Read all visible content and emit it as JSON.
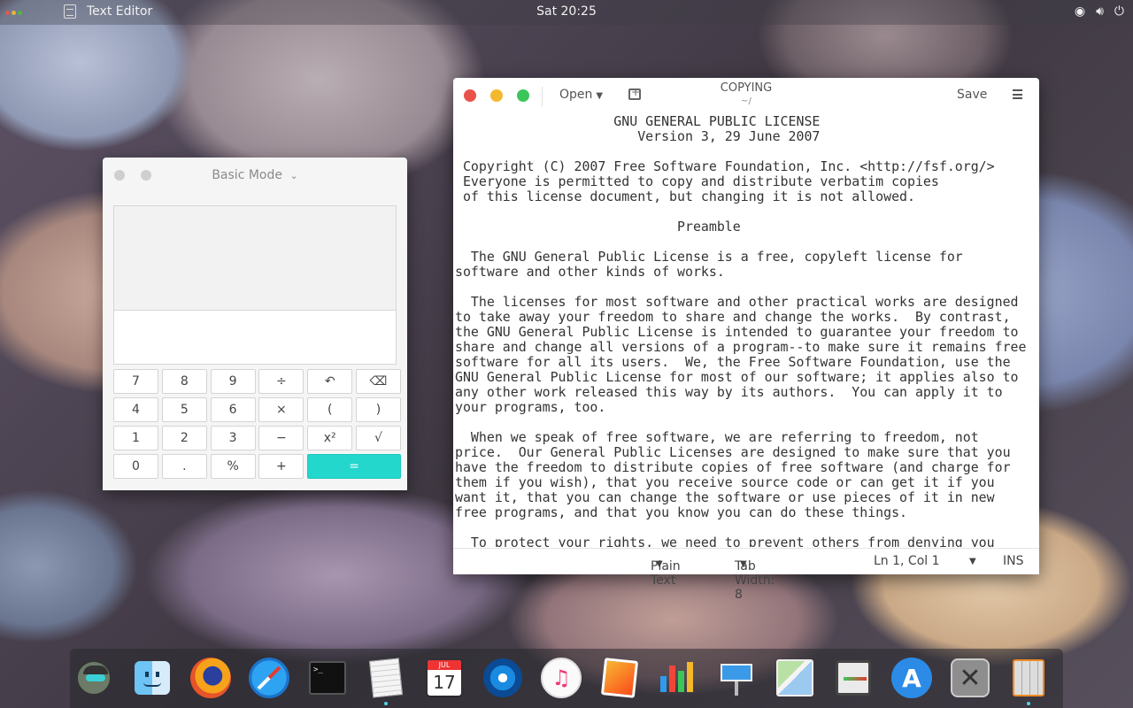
{
  "top_panel": {
    "app_name": "Text Editor",
    "clock": "Sat 20:25"
  },
  "calculator": {
    "mode": "Basic Mode",
    "keys": [
      {
        "label": "7",
        "name": "key-7"
      },
      {
        "label": "8",
        "name": "key-8"
      },
      {
        "label": "9",
        "name": "key-9"
      },
      {
        "label": "÷",
        "name": "key-divide"
      },
      {
        "label": "↶",
        "name": "undo-key"
      },
      {
        "label": "⌫",
        "name": "backspace-key"
      },
      {
        "label": "4",
        "name": "key-4"
      },
      {
        "label": "5",
        "name": "key-5"
      },
      {
        "label": "6",
        "name": "key-6"
      },
      {
        "label": "×",
        "name": "key-multiply"
      },
      {
        "label": "(",
        "name": "key-open-paren"
      },
      {
        "label": ")",
        "name": "key-close-paren"
      },
      {
        "label": "1",
        "name": "key-1"
      },
      {
        "label": "2",
        "name": "key-2"
      },
      {
        "label": "3",
        "name": "key-3"
      },
      {
        "label": "−",
        "name": "key-minus"
      },
      {
        "label": "x²",
        "name": "key-square"
      },
      {
        "label": "√",
        "name": "key-sqrt"
      },
      {
        "label": "0",
        "name": "key-0"
      },
      {
        "label": ".",
        "name": "key-decimal"
      },
      {
        "label": "%",
        "name": "key-percent"
      },
      {
        "label": "+",
        "name": "key-plus"
      },
      {
        "label": "=",
        "name": "key-equals"
      }
    ]
  },
  "editor": {
    "open_label": "Open",
    "title": "COPYING",
    "subtitle": "~/",
    "save_label": "Save",
    "content_lines": [
      "                    GNU GENERAL PUBLIC LICENSE",
      "                       Version 3, 29 June 2007",
      "",
      " Copyright (C) 2007 Free Software Foundation, Inc. <http://fsf.org/>",
      " Everyone is permitted to copy and distribute verbatim copies",
      " of this license document, but changing it is not allowed.",
      "",
      "                            Preamble",
      "",
      "  The GNU General Public License is a free, copyleft license for",
      "software and other kinds of works.",
      "",
      "  The licenses for most software and other practical works are designed",
      "to take away your freedom to share and change the works.  By contrast,",
      "the GNU General Public License is intended to guarantee your freedom to",
      "share and change all versions of a program--to make sure it remains free",
      "software for all its users.  We, the Free Software Foundation, use the",
      "GNU General Public License for most of our software; it applies also to",
      "any other work released this way by its authors.  You can apply it to",
      "your programs, too.",
      "",
      "  When we speak of free software, we are referring to freedom, not",
      "price.  Our General Public Licenses are designed to make sure that you",
      "have the freedom to distribute copies of free software (and charge for",
      "them if you wish), that you receive source code or can get it if you",
      "want it, that you can change the software or use pieces of it in new",
      "free programs, and that you know you can do these things.",
      "",
      "  To protect your rights, we need to prevent others from denying you"
    ],
    "status": {
      "language": "Plain Text",
      "tab_width": "Tab Width: 8",
      "position": "Ln 1, Col 1",
      "mode": "INS"
    }
  },
  "dock": {
    "items": [
      {
        "name": "user-avatar-icon",
        "running": false
      },
      {
        "name": "finder-icon",
        "running": false
      },
      {
        "name": "firefox-icon",
        "running": false
      },
      {
        "name": "safari-icon",
        "running": false
      },
      {
        "name": "terminal-icon",
        "running": false
      },
      {
        "name": "text-editor-icon",
        "running": true
      },
      {
        "name": "calendar-icon",
        "running": false,
        "month": "JUL",
        "day": "17"
      },
      {
        "name": "browser-icon",
        "running": false
      },
      {
        "name": "music-icon",
        "running": false
      },
      {
        "name": "pages-icon",
        "running": false
      },
      {
        "name": "numbers-icon",
        "running": false
      },
      {
        "name": "keynote-icon",
        "running": false
      },
      {
        "name": "maps-icon",
        "running": false
      },
      {
        "name": "notes-icon",
        "running": false
      },
      {
        "name": "app-store-icon",
        "running": false
      },
      {
        "name": "system-settings-icon",
        "running": false
      },
      {
        "name": "calculator-icon",
        "running": true
      }
    ]
  }
}
